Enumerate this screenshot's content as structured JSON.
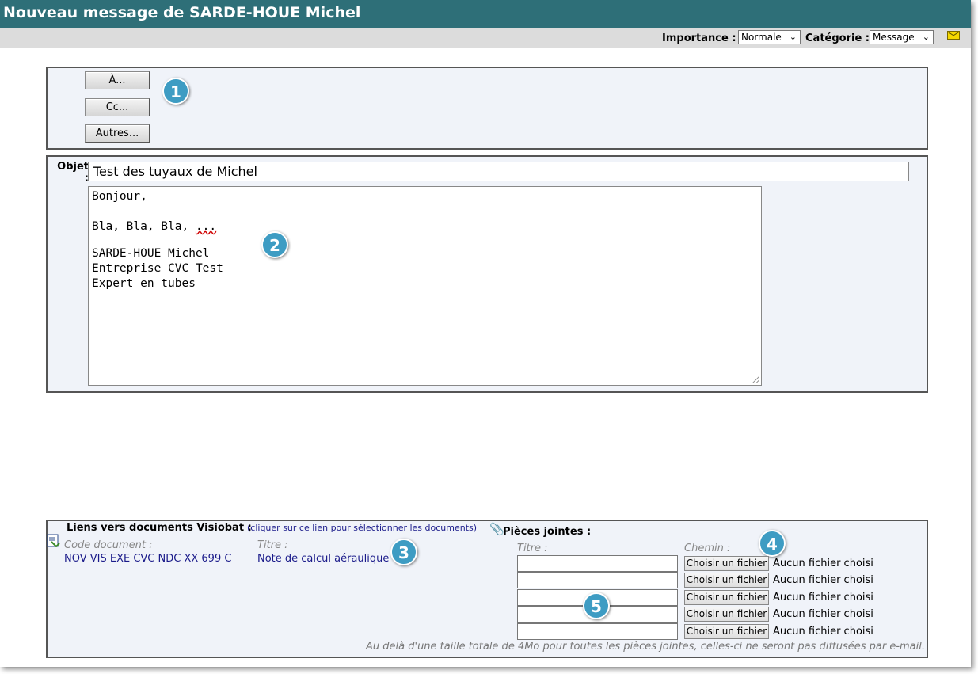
{
  "window": {
    "title": "Nouveau message de SARDE-HOUE Michel"
  },
  "toolbar": {
    "importance_label": "Importance :",
    "importance_value": "Normale",
    "category_label": "Catégorie :",
    "category_value": "Message",
    "mail_icon": "envelope-icon"
  },
  "recipients": {
    "to_label": "À...",
    "cc_label": "Cc...",
    "others_label": "Autres..."
  },
  "message": {
    "subject_label": "Objet :",
    "subject_value": "Test des tuyaux de Michel",
    "body_lines": [
      "Bonjour,",
      "",
      "Bla, Bla, Bla, ...",
      "",
      "SARDE-HOUE Michel",
      "Entreprise CVC Test",
      "Expert en tubes"
    ]
  },
  "links": {
    "heading": "Liens vers documents Visiobat :",
    "select_link": "(cliquer sur ce lien pour sélectionner les documents)",
    "code_header": "Code document :",
    "title_header": "Titre :",
    "doc_code": "NOV VIS EXE CVC NDC XX 699 C",
    "doc_title": "Note de calcul aéraulique"
  },
  "attachments": {
    "heading": "Pièces jointes :",
    "title_header": "Titre :",
    "path_header": "Chemin :",
    "choose_label": "Choisir un fichier",
    "no_file": "Aucun fichier choisi",
    "footnote": "Au delà d'une taille totale de 4Mo pour toutes les pièces jointes, celles-ci ne seront pas diffusées par e-mail."
  },
  "badges": [
    "1",
    "2",
    "3",
    "4",
    "5"
  ]
}
